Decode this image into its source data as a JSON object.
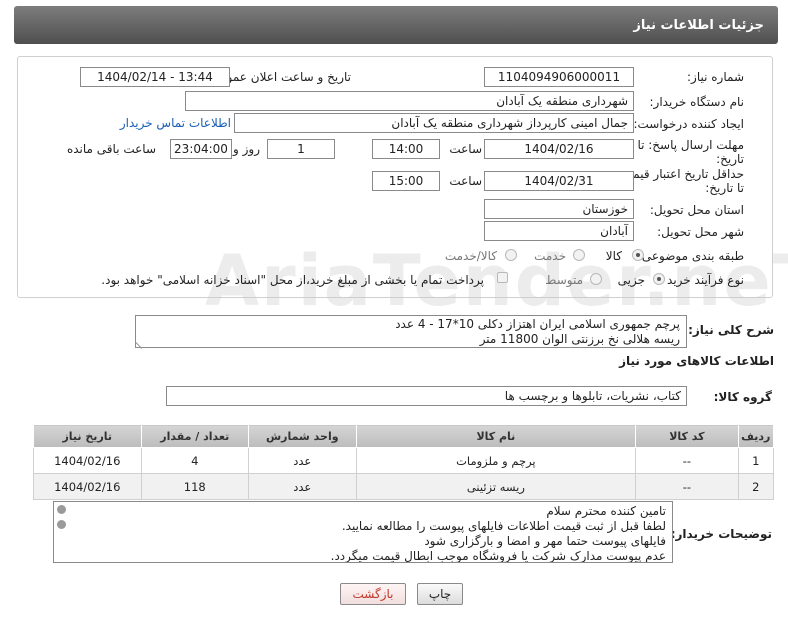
{
  "header": {
    "title": "جزئیات اطلاعات نیاز"
  },
  "form": {
    "need_number_label": "شماره نیاز:",
    "need_number": "1104094906000011",
    "announce_label": "تاریخ و ساعت اعلان عمومی:",
    "announce_value": "1404/02/14 - 13:44",
    "buyer_org_label": "نام دستگاه خریدار:",
    "buyer_org": "شهرداری منطقه یک آبادان",
    "creator_label": "ایجاد کننده درخواست:",
    "creator": "جمال امینی کارپرداز شهرداری منطقه یک آبادان",
    "contact_link": "اطلاعات تماس خریدار",
    "deadline_label_1": "مهلت ارسال پاسخ: تا",
    "deadline_label_2": "تاریخ:",
    "deadline_date": "1404/02/16",
    "time_label": "ساعت",
    "deadline_time": "14:00",
    "days_value": "1",
    "days_label": "روز و",
    "remaining_time": "23:04:00",
    "remaining_label": "ساعت باقی مانده",
    "validity_label_1": "حداقل تاریخ اعتبار قیمت:",
    "validity_label_2": "تا تاریخ:",
    "validity_date": "1404/02/31",
    "validity_time": "15:00",
    "province_label": "استان محل تحویل:",
    "province": "خوزستان",
    "city_label": "شهر محل تحویل:",
    "city": "آبادان",
    "category_label": "طبقه بندی موضوعی:",
    "category_options": [
      "کالا",
      "خدمت",
      "کالا/خدمت"
    ],
    "process_label": "نوع فرآیند خرید :",
    "process_options": [
      "جزیی",
      "متوسط"
    ],
    "payment_note": "پرداخت تمام یا بخشی از مبلغ خرید،از محل \"اسناد خزانه اسلامی\" خواهد بود."
  },
  "description": {
    "label": "شرح کلی نیاز:",
    "lines": [
      "پرچم جمهوری اسلامی ایران اهتزاز دکلی 10*17 - 4 عدد",
      "ریسه هلالی نخ برزنتی الوان 11800 متر"
    ]
  },
  "goods_info": {
    "title": "اطلاعات کالاهای مورد نیاز",
    "group_label": "گروه کالا:",
    "group_value": "کتاب، نشریات، تابلوها و برچسب ها"
  },
  "table": {
    "headers": [
      "ردیف",
      "کد کالا",
      "نام کالا",
      "واحد شمارش",
      "تعداد / مقدار",
      "تاریخ نیاز"
    ],
    "rows": [
      [
        "1",
        "--",
        "پرچم و ملزومات",
        "عدد",
        "4",
        "1404/02/16"
      ],
      [
        "2",
        "--",
        "ریسه تزئینی",
        "عدد",
        "118",
        "1404/02/16"
      ]
    ]
  },
  "notes": {
    "label": "توضیحات خریدار:",
    "lines": [
      "تامین کننده محترم سلام",
      "لطفا قبل از ثبت قیمت اطلاعات فایلهای پیوست را مطالعه نمایید.",
      "فایلهای پیوست حتما مهر و امضا و بارگزاری شود",
      "عدم پیوست مدارک شرکت یا فروشگاه موجب ابطال قیمت میگردد."
    ]
  },
  "buttons": {
    "print": "چاپ",
    "back": "بازگشت"
  },
  "watermark": "AriaTender.neT",
  "colors": {
    "header": "#5f5f5f",
    "link": "#1a5fb4",
    "back_button_text": "#c0392b"
  }
}
